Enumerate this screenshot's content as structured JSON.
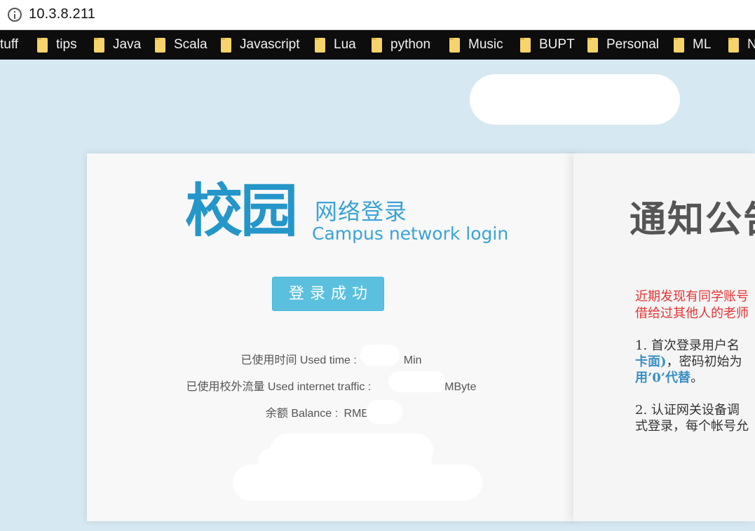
{
  "browser": {
    "url": "10.3.8.211",
    "bookmarks": [
      "tuff",
      "tips",
      "Java",
      "Scala",
      "Javascript",
      "Lua",
      "python",
      "Music",
      "BUPT",
      "Personal",
      "ML",
      "N"
    ]
  },
  "login_card": {
    "logo_big": "校园",
    "logo_small": "网络登录",
    "logo_en": "Campus network login",
    "status_button": "登录成功",
    "used_time_label": "已使用时间 Used time :",
    "used_time_value": "",
    "used_time_unit": "Min",
    "traffic_label": "已使用校外流量 Used internet traffic :",
    "traffic_value": "",
    "traffic_unit": "MByte",
    "balance_label": "余额 Balance :",
    "balance_value": "RMB"
  },
  "notice_card": {
    "title": "通知公告",
    "red_line_1": "近期发现有同学账号",
    "red_line_2": "借给过其他人的老师",
    "item1_line1": "1.   首次登录用户名",
    "item1_line2_blue": "卡面)",
    "item1_line2_rest": "，密码初始为",
    "item1_line3_blue": "用’0’代替",
    "item1_line3_rest": "。",
    "item2_line1": "2.   认证网关设备调",
    "item2_line2": "式登录，每个帐号允"
  },
  "colors": {
    "accent": "#5bc0de",
    "logo": "#2596c9",
    "page_bg": "#d6e8f2",
    "notice_red": "#e53333",
    "notice_blue": "#3a8fc4"
  }
}
